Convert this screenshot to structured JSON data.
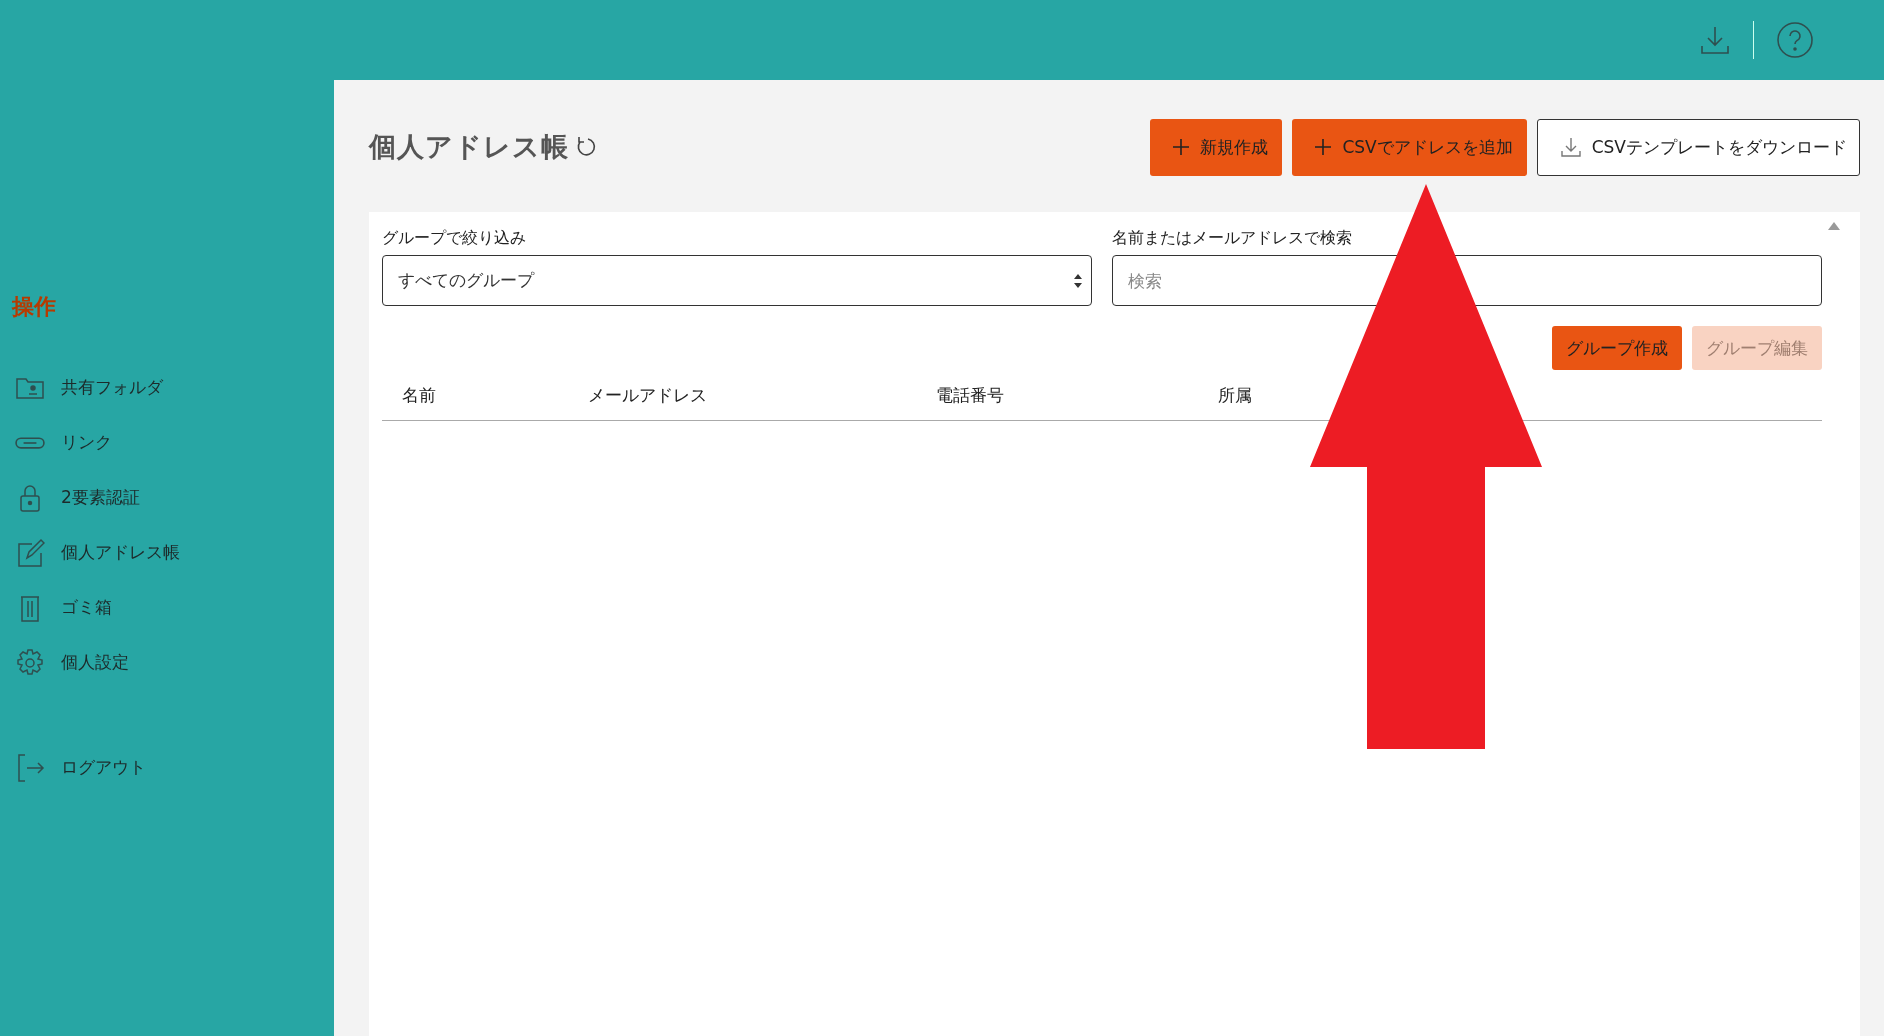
{
  "sidebar": {
    "heading": "操作",
    "items": [
      {
        "label": "共有フォルダ"
      },
      {
        "label": "リンク"
      },
      {
        "label": "2要素認証"
      },
      {
        "label": "個人アドレス帳"
      },
      {
        "label": "ゴミ箱"
      },
      {
        "label": "個人設定"
      }
    ],
    "logout": {
      "label": "ログアウト"
    }
  },
  "page": {
    "title": "個人アドレス帳",
    "actions": [
      {
        "label": "新規作成",
        "kind": "primary"
      },
      {
        "label": "CSVでアドレスを追加",
        "kind": "primary"
      },
      {
        "label": "CSVテンプレートをダウンロード",
        "kind": "outline"
      }
    ]
  },
  "filter": {
    "label": "グループで絞り込み",
    "value": "すべてのグループ"
  },
  "search": {
    "label": "名前またはメールアドレスで検索",
    "placeholder": "検索"
  },
  "group_buttons": [
    {
      "label": "グループ作成",
      "disabled": false
    },
    {
      "label": "グループ編集",
      "disabled": true
    }
  ],
  "table": {
    "columns": [
      "名前",
      "メールアドレス",
      "電話番号",
      "所属"
    ]
  }
}
